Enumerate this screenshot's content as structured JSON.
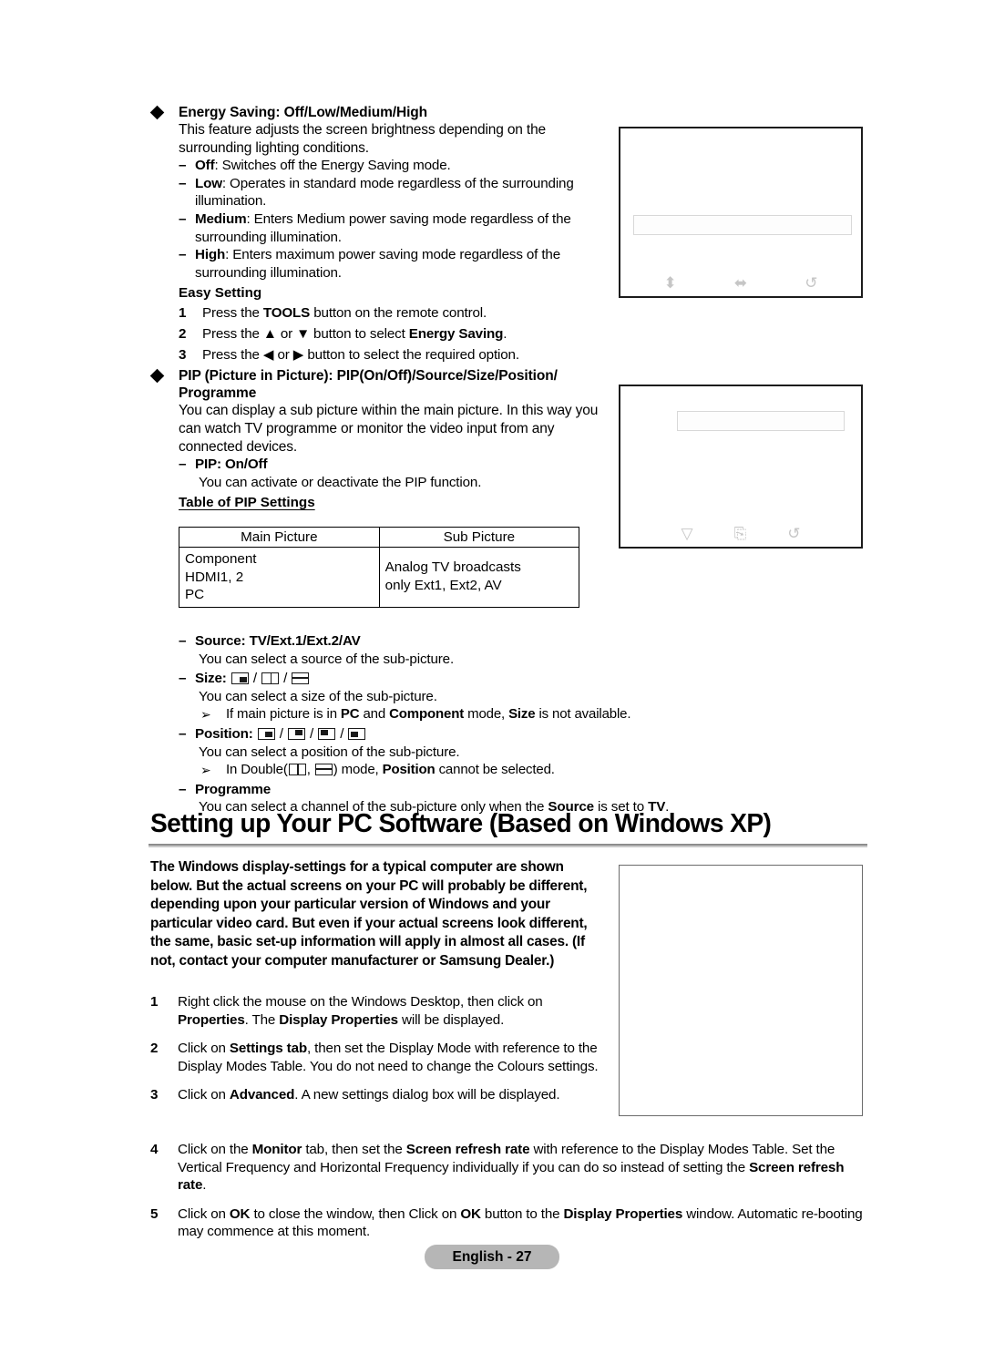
{
  "page": {
    "footer_label": "English - 27"
  },
  "energy_saving": {
    "bullet_title_bold": "Energy Saving",
    "bullet_title_rest": ": Off/Low/Medium/High",
    "intro": "This feature adjusts the screen brightness depending on the surrounding lighting conditions.",
    "options": [
      {
        "dash": "–",
        "term": "Off",
        "desc": ": Switches off the Energy Saving mode."
      },
      {
        "dash": "–",
        "term": "Low",
        "desc": ": Operates in standard mode regardless of the surrounding illumination."
      },
      {
        "dash": "–",
        "term": "Medium",
        "desc": ": Enters Medium power saving mode regardless of the surrounding illumination."
      },
      {
        "dash": "–",
        "term": "High",
        "desc": ": Enters maximum power saving mode regardless of the surrounding illumination."
      }
    ],
    "easy_setting_heading": "Easy Setting",
    "steps": [
      {
        "num": "1",
        "pre": "Press the ",
        "bold": "TOOLS",
        "post": " button on the remote control."
      },
      {
        "num": "2",
        "pre": "Press the ▲ or ▼ button to select ",
        "bold": "Energy Saving",
        "post": "."
      },
      {
        "num": "3",
        "pre": "Press the ◀ or ▶ button to select the required option.",
        "bold": "",
        "post": ""
      }
    ]
  },
  "pip": {
    "bullet_title_line1": "PIP (Picture in Picture): PIP(On/Off)/Source/Size/Position/",
    "bullet_title_line2": "Programme",
    "intro": "You can display a sub picture within the main picture. In this way you can watch TV programme or monitor the video input from any connected devices.",
    "pip_onoff_heading": "PIP: On/Off",
    "pip_onoff_desc": "You can activate or deactivate the PIP function.",
    "table_heading": "Table of PIP Settings",
    "table": {
      "columns": [
        "Main Picture",
        "Sub Picture"
      ],
      "rows": [
        {
          "main": [
            "Component",
            "HDMI1, 2",
            "PC"
          ],
          "sub": [
            "Analog TV broadcasts",
            "only Ext1, Ext2, AV"
          ]
        }
      ]
    },
    "source_heading": "Source: TV/Ext.1/Ext.2/AV",
    "source_desc": "You can select a source of the sub-picture.",
    "size_heading_label": "Size:",
    "size_desc": "You can select a size of the sub-picture.",
    "size_note_pre": "If main picture is in ",
    "size_note_b1": "PC",
    "size_note_mid1": " and ",
    "size_note_b2": "Component",
    "size_note_mid2": " mode, ",
    "size_note_b3": "Size",
    "size_note_end": " is not available.",
    "position_heading_label": "Position:",
    "position_desc": "You can select a position of the sub-picture.",
    "position_note_pre": "In Double(",
    "position_note_mid": ", ",
    "position_note_post": ") mode, ",
    "position_note_b": "Position",
    "position_note_end": " cannot be selected.",
    "programme_heading": "Programme",
    "programme_desc_pre": "You can select a channel of the sub-picture only when the ",
    "programme_desc_b1": "Source",
    "programme_desc_mid": " is set to ",
    "programme_desc_b2": "TV",
    "programme_desc_end": "."
  },
  "pc_section": {
    "heading": "Setting up Your PC Software (Based on Windows XP)",
    "intro": "The Windows display-settings for a typical computer are shown below. But the actual screens on your PC will probably be different, depending upon your particular version of Windows and your particular video card. But even if your actual screens look different, the same, basic set-up information will apply in almost all cases. (If not, contact your computer manufacturer or Samsung Dealer.)",
    "steps_upper": [
      {
        "num": "1",
        "t1": "Right click the mouse on the Windows Desktop, then click on ",
        "b1": "Properties",
        "t2": ". The ",
        "b2": "Display Properties",
        "t3": " will be displayed."
      },
      {
        "num": "2",
        "t1": "Click on ",
        "b1": "Settings tab",
        "t2": ", then set the Display Mode with reference to the Display Modes Table. You do not need to change the Colours settings.",
        "b2": "",
        "t3": ""
      },
      {
        "num": "3",
        "t1": "Click on ",
        "b1": "Advanced",
        "t2": ". A new settings dialog box will be displayed.",
        "b2": "",
        "t3": ""
      }
    ],
    "steps_lower": [
      {
        "num": "4",
        "t1": "Click on the ",
        "b1": "Monitor",
        "t2": " tab, then set the ",
        "b2": "Screen refresh rate",
        "t3": " with reference to the Display Modes Table. Set the Vertical Frequency and Horizontal Frequency individually if you can do so instead of setting the ",
        "b3": "Screen refresh rate",
        "t4": "."
      },
      {
        "num": "5",
        "t1": "Click on ",
        "b1": "OK",
        "t2": " to close the window, then Click on ",
        "b2": "OK",
        "t3": " button to the ",
        "b3": "Display Properties",
        "t4": " window. Automatic re-booting may commence at this moment."
      }
    ]
  },
  "osd_illustrations": [
    {
      "name": "energy-saving-osd",
      "icons": [
        "up-down-arrow-icon",
        "left-right-arrow-icon",
        "return-arrow-icon"
      ]
    },
    {
      "name": "pip-osd",
      "icons": [
        "down-arrow-icon",
        "enter-icon",
        "return-arrow-icon"
      ]
    },
    {
      "name": "display-properties-dialog",
      "icons": []
    }
  ]
}
